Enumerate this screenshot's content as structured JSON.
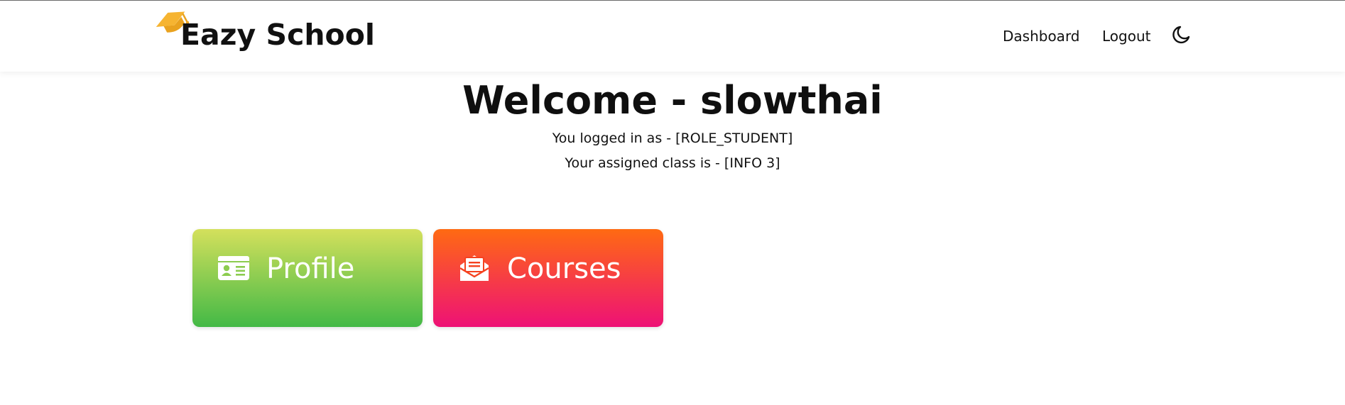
{
  "brand": {
    "name": "Eazy School",
    "icon": "graduation-cap-icon",
    "icon_color": "#f6b431"
  },
  "nav": {
    "dashboard": "Dashboard",
    "logout": "Logout",
    "theme_icon": "moon-icon"
  },
  "welcome": {
    "title": "Welcome - slowthai",
    "role_line": "You logged in as - [ROLE_STUDENT]",
    "class_line": "Your assigned class is - [INFO 3]"
  },
  "cards": [
    {
      "label": "Profile",
      "icon": "id-card-icon",
      "colors": [
        "#d4e05c",
        "#43b946"
      ]
    },
    {
      "label": "Courses",
      "icon": "envelope-open-icon",
      "colors": [
        "#ff6a12",
        "#ee1176"
      ]
    }
  ]
}
